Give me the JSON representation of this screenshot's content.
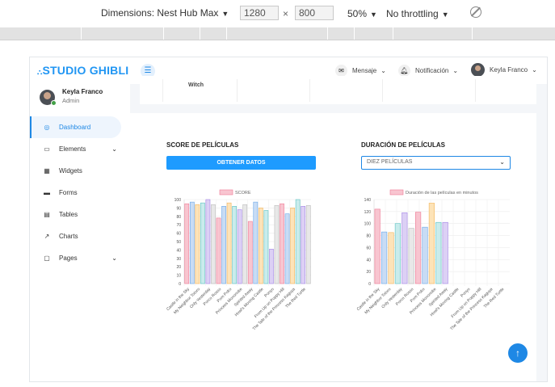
{
  "devtools": {
    "device": "Dimensions: Nest Hub Max",
    "width": "1280",
    "height": "800",
    "times": "×",
    "zoom": "50%",
    "throttle": "No throttling"
  },
  "header": {
    "brand": "STUDIO GHIBLI",
    "brand_icon": "⛬",
    "mensaje": "Mensaje",
    "notificacion": "Notificación",
    "user": "Keyla Franco"
  },
  "sidebar": {
    "user_name": "Keyla Franco",
    "user_role": "Admin",
    "items": [
      {
        "label": "Dashboard",
        "icon": "◎",
        "chevron": ""
      },
      {
        "label": "Elements",
        "icon": "▭",
        "chevron": "⌄"
      },
      {
        "label": "Widgets",
        "icon": "▦",
        "chevron": ""
      },
      {
        "label": "Forms",
        "icon": "▬",
        "chevron": ""
      },
      {
        "label": "Tables",
        "icon": "▤",
        "chevron": ""
      },
      {
        "label": "Charts",
        "icon": "↗",
        "chevron": ""
      },
      {
        "label": "Pages",
        "icon": "▢",
        "chevron": "⌄"
      }
    ]
  },
  "content": {
    "top_row_text": "Witch",
    "score_title": "SCORE DE PELÍCULAS",
    "score_button": "OBTENER DATOS",
    "duration_title": "DURACIÓN DE PELÍCULAS",
    "duration_select": "DIEZ PELÍCULAS"
  },
  "colors": {
    "accent": "#1e88e5",
    "brand": "#2196f3",
    "button": "#1e9bff"
  },
  "chart_data": [
    {
      "type": "bar",
      "title": "",
      "legend": "SCORE",
      "ylim": [
        0,
        100
      ],
      "yticks": [
        0,
        10,
        20,
        30,
        40,
        50,
        60,
        70,
        80,
        90,
        100
      ],
      "categories": [
        "Castle in the Sky",
        "My Neighbor Totoro",
        "Only Yesterday",
        "Porco Rosso",
        "Pom Poko",
        "Princess Mononoke",
        "Spirited Away",
        "Howl's Moving Castle",
        "Ponyo",
        "From Up on Poppy Hill",
        "The Tale of the Princess Kaguya",
        "The Red Turtle"
      ],
      "values": [
        95,
        97,
        94,
        96,
        100,
        94,
        78,
        92,
        96,
        92,
        88,
        94,
        74,
        97,
        90,
        87,
        41,
        93,
        95,
        83,
        90,
        100,
        92,
        93
      ],
      "colors": [
        "#f8c5d0",
        "#c8dcf5",
        "#fde3b8",
        "#c9ecec",
        "#dcd0f5",
        "#e8e8e8"
      ]
    },
    {
      "type": "bar",
      "title": "",
      "legend": "Duración de las películas en minutos",
      "ylim": [
        0,
        140
      ],
      "yticks": [
        0,
        20,
        40,
        60,
        80,
        100,
        120,
        140
      ],
      "categories": [
        "Castle in the Sky",
        "My Neighbor Totoro",
        "Only Yesterday",
        "Porco Rosso",
        "Pom Poko",
        "Princess Mononoke",
        "Spirited Away",
        "Howl's Moving Castle",
        "Ponyo",
        "From Up on Poppy Hill",
        "The Tale of the Princess Kaguya",
        "The Red Turtle"
      ],
      "values": [
        124,
        86,
        85,
        100,
        118,
        92,
        119,
        94,
        134,
        102,
        102
      ],
      "colors": [
        "#f8c5d0",
        "#c8dcf5",
        "#fde3b8",
        "#c9ecec",
        "#dcd0f5",
        "#e8e8e8"
      ]
    }
  ]
}
